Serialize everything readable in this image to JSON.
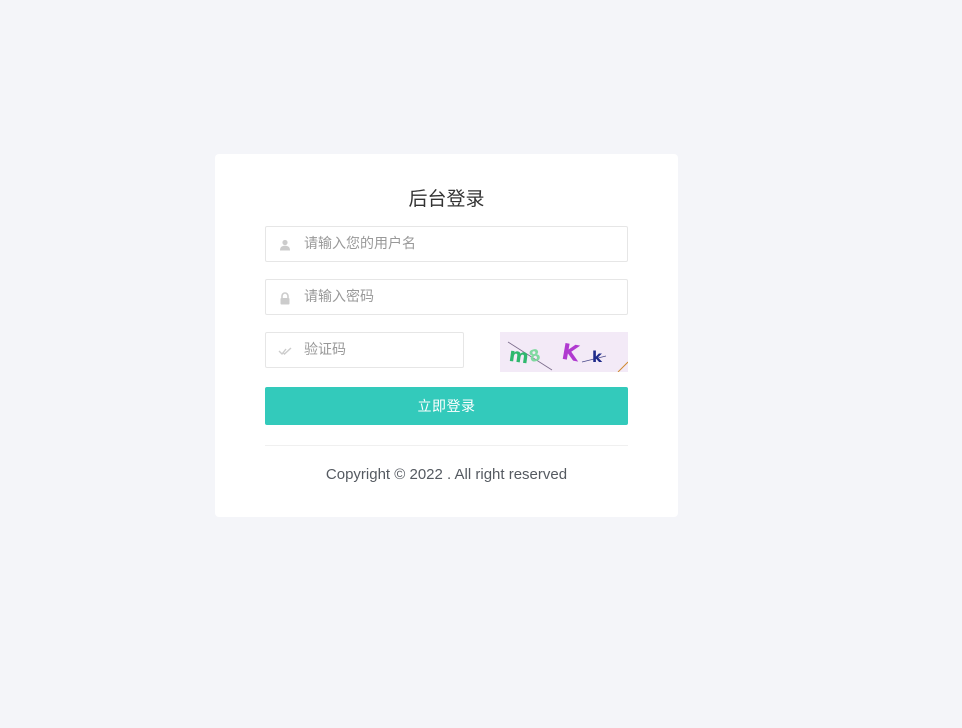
{
  "login": {
    "title": "后台登录",
    "username_placeholder": "请输入您的用户名",
    "password_placeholder": "请输入密码",
    "captcha_placeholder": "验证码",
    "captcha_text": "m8 K k",
    "submit_label": "立即登录",
    "copyright": "Copyright © 2022 . All right reserved"
  },
  "colors": {
    "page_bg": "#f4f5f9",
    "card_bg": "#ffffff",
    "accent": "#33cabb",
    "placeholder": "#999999",
    "icon": "#cccccc"
  },
  "icons": {
    "username": "user-icon",
    "password": "lock-icon",
    "captcha": "check-icon"
  }
}
